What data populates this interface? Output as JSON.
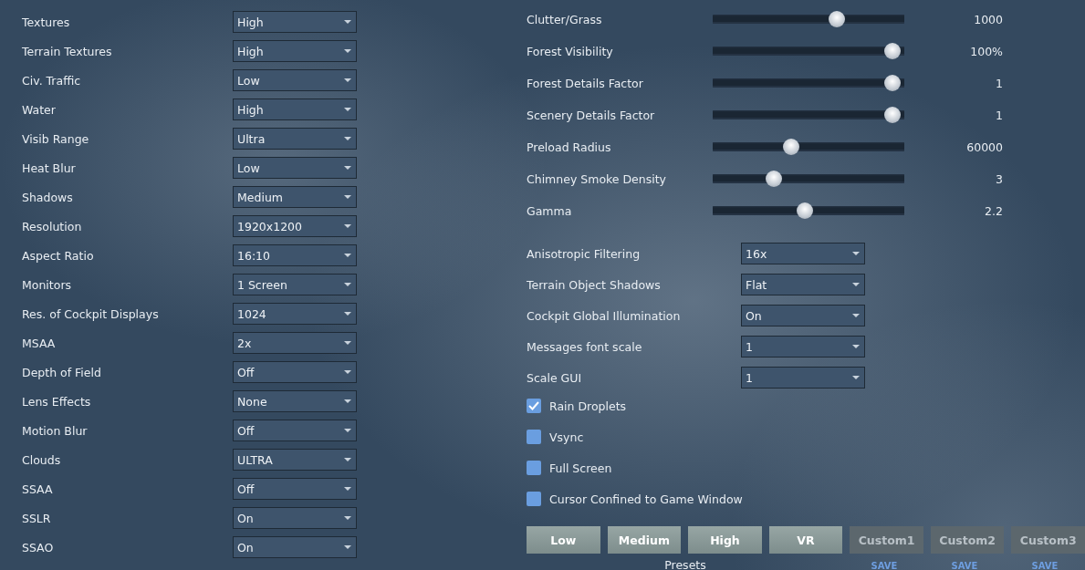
{
  "dropdown_settings": [
    {
      "label": "Textures",
      "value": "High"
    },
    {
      "label": "Terrain Textures",
      "value": "High"
    },
    {
      "label": "Civ. Traffic",
      "value": "Low"
    },
    {
      "label": "Water",
      "value": "High"
    },
    {
      "label": "Visib Range",
      "value": "Ultra"
    },
    {
      "label": "Heat Blur",
      "value": "Low"
    },
    {
      "label": "Shadows",
      "value": "Medium"
    },
    {
      "label": "Resolution",
      "value": "1920x1200"
    },
    {
      "label": "Aspect Ratio",
      "value": "16:10"
    },
    {
      "label": "Monitors",
      "value": "1 Screen"
    },
    {
      "label": "Res. of Cockpit Displays",
      "value": "1024"
    },
    {
      "label": "MSAA",
      "value": "2x"
    },
    {
      "label": "Depth of Field",
      "value": "Off"
    },
    {
      "label": "Lens Effects",
      "value": "None"
    },
    {
      "label": "Motion Blur",
      "value": "Off"
    },
    {
      "label": "Clouds",
      "value": "ULTRA"
    },
    {
      "label": "SSAA",
      "value": "Off"
    },
    {
      "label": "SSLR",
      "value": "On"
    },
    {
      "label": "SSAO",
      "value": "On"
    }
  ],
  "sliders": [
    {
      "label": "Clutter/Grass",
      "level": 0.66,
      "reading": "1000"
    },
    {
      "label": "Forest Visibility",
      "level": 0.98,
      "reading": "100%"
    },
    {
      "label": "Forest Details Factor",
      "level": 0.98,
      "reading": "1"
    },
    {
      "label": "Scenery Details Factor",
      "level": 0.98,
      "reading": "1"
    },
    {
      "label": "Preload Radius",
      "level": 0.4,
      "reading": "60000"
    },
    {
      "label": "Chimney Smoke Density",
      "level": 0.3,
      "reading": "3"
    },
    {
      "label": "Gamma",
      "level": 0.48,
      "reading": "2.2"
    }
  ],
  "right_dropdowns": [
    {
      "label": "Anisotropic Filtering",
      "value": "16x"
    },
    {
      "label": "Terrain Object Shadows",
      "value": "Flat"
    },
    {
      "label": "Cockpit Global Illumination",
      "value": "On"
    },
    {
      "label": "Messages font scale",
      "value": "1"
    },
    {
      "label": "Scale GUI",
      "value": "1"
    }
  ],
  "checkboxes": [
    {
      "label": "Rain Droplets",
      "checked": true
    },
    {
      "label": "Vsync",
      "checked": false
    },
    {
      "label": "Full Screen",
      "checked": false
    },
    {
      "label": "Cursor Confined to Game Window",
      "checked": false
    }
  ],
  "presets": {
    "caption": "Presets",
    "buttons": [
      {
        "label": "Low",
        "kind": "preset"
      },
      {
        "label": "Medium",
        "kind": "preset"
      },
      {
        "label": "High",
        "kind": "preset"
      },
      {
        "label": "VR",
        "kind": "preset"
      },
      {
        "label": "Custom1",
        "kind": "custom",
        "save": "SAVE"
      },
      {
        "label": "Custom2",
        "kind": "custom",
        "save": "SAVE"
      },
      {
        "label": "Custom3",
        "kind": "custom",
        "save": "SAVE"
      }
    ]
  }
}
